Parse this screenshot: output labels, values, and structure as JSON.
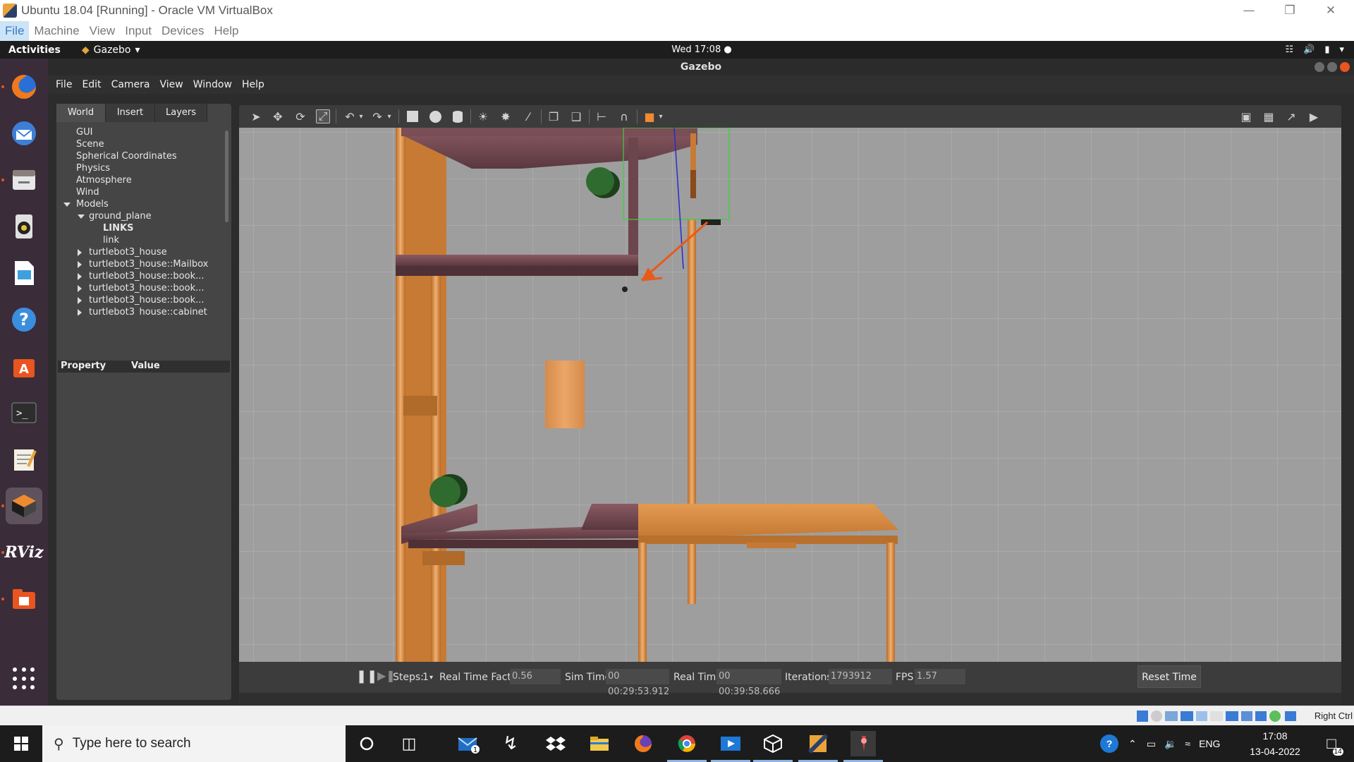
{
  "host": {
    "title": "Ubuntu 18.04 [Running] - Oracle VM VirtualBox",
    "menu": [
      "File",
      "Machine",
      "View",
      "Input",
      "Devices",
      "Help"
    ],
    "host_key": "Right Ctrl"
  },
  "ubuntu": {
    "activities": "Activities",
    "app_menu": "Gazebo",
    "clock": "Wed 17:08 ●",
    "dock_icons": [
      "firefox-icon",
      "thunderbird-icon",
      "files-icon",
      "rhythmbox-icon",
      "libreoffice-impress-icon",
      "help-icon",
      "software-center-icon",
      "terminal-icon",
      "text-editor-icon",
      "gazebo-icon",
      "rviz-icon",
      "file-manager-icon"
    ],
    "rviz_label": "RViz"
  },
  "gazebo": {
    "window_title": "Gazebo",
    "menu": [
      "File",
      "Edit",
      "Camera",
      "View",
      "Window",
      "Help"
    ],
    "tabs": [
      "World",
      "Insert",
      "Layers"
    ],
    "tree": [
      {
        "label": "GUI",
        "indent": 0,
        "arrow": "none"
      },
      {
        "label": "Scene",
        "indent": 0,
        "arrow": "none"
      },
      {
        "label": "Spherical Coordinates",
        "indent": 0,
        "arrow": "none"
      },
      {
        "label": "Physics",
        "indent": 0,
        "arrow": "none"
      },
      {
        "label": "Atmosphere",
        "indent": 0,
        "arrow": "none"
      },
      {
        "label": "Wind",
        "indent": 0,
        "arrow": "none"
      },
      {
        "label": "Models",
        "indent": 0,
        "arrow": "down"
      },
      {
        "label": "ground_plane",
        "indent": 1,
        "arrow": "down"
      },
      {
        "label": "LINKS",
        "indent": 2,
        "arrow": "none",
        "bold": true
      },
      {
        "label": "link",
        "indent": 2,
        "arrow": "none"
      },
      {
        "label": "turtlebot3_house",
        "indent": 1,
        "arrow": "right"
      },
      {
        "label": "turtlebot3_house::Mailbox",
        "indent": 1,
        "arrow": "right"
      },
      {
        "label": "turtlebot3_house::book...",
        "indent": 1,
        "arrow": "right"
      },
      {
        "label": "turtlebot3_house::book...",
        "indent": 1,
        "arrow": "right"
      },
      {
        "label": "turtlebot3_house::book...",
        "indent": 1,
        "arrow": "right"
      },
      {
        "label": "turtlebot3_house::cabinet",
        "indent": 1,
        "arrow": "right"
      }
    ],
    "property_header": {
      "property": "Property",
      "value": "Value"
    },
    "status": {
      "steps_label": "Steps:",
      "steps_value": "1",
      "rtf_label": "Real Time Factor:",
      "rtf_value": "0.56",
      "sim_time_label": "Sim Time:",
      "sim_time_value": "00 00:29:53.912",
      "real_time_label": "Real Time:",
      "real_time_value": "00 00:39:58.666",
      "iterations_label": "Iterations:",
      "iterations_value": "1793912",
      "fps_label": "FPS:",
      "fps_value": "1.57",
      "reset_label": "Reset Time"
    }
  },
  "taskbar": {
    "search_placeholder": "Type here to search",
    "language": "ENG",
    "time": "17:08",
    "date": "13-04-2022",
    "notifications": "14",
    "mail_badge": "1"
  },
  "colors": {
    "accent": "#e95420",
    "ground": "#9e9e9e",
    "wood": "#d98a3c"
  }
}
